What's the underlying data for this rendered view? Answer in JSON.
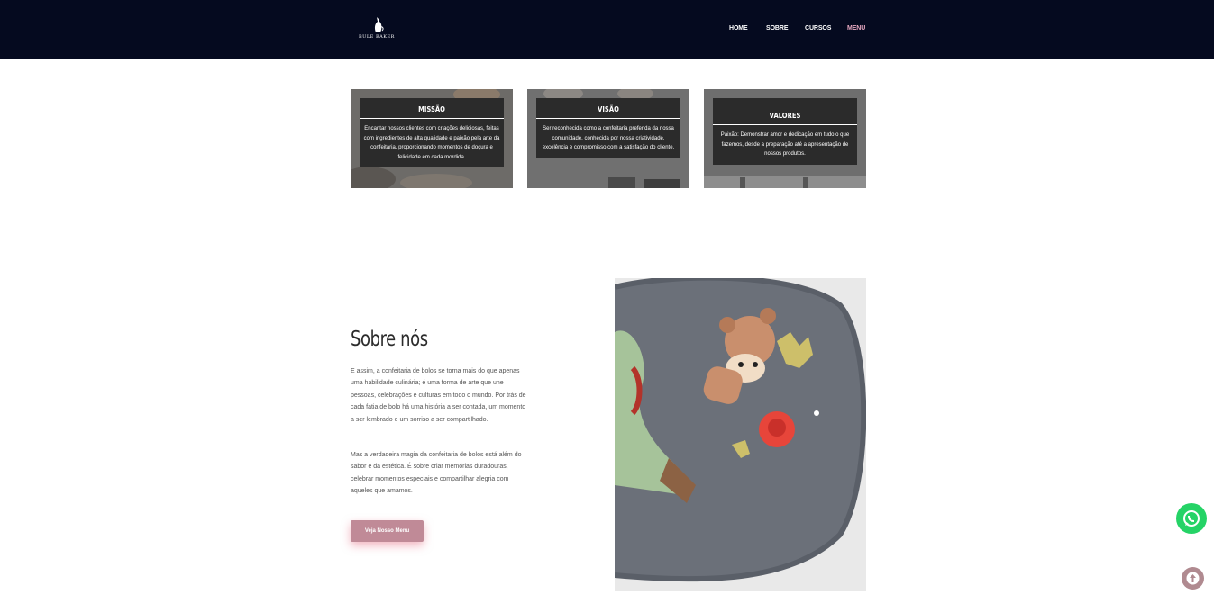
{
  "header": {
    "logo_text": "BULE BAKER",
    "nav": [
      {
        "label": "HOME"
      },
      {
        "label": "SOBRE"
      },
      {
        "label": "CURSOS"
      },
      {
        "label": "MENU"
      }
    ],
    "active_nav": "MENU"
  },
  "cards": [
    {
      "title": "MISSÃO",
      "text": "Encantar nossos clientes com criações deliciosas, feitas com ingredientes de alta qualidade e paixão pela arte da confeitaria, proporcionando momentos de doçura e felicidade em cada mordida."
    },
    {
      "title": "VISÃO",
      "text": "Ser reconhecida como a confeitaria preferida da nossa comunidade, conhecida por nossa criatividade, excelência e compromisso com a satisfação do cliente."
    },
    {
      "title": "VALORES",
      "text": "Paixão: Demonstrar amor e dedicação em tudo o que fazemos, desde a preparação até a apresentação de nossos produtos."
    }
  ],
  "about": {
    "title": "Sobre nós",
    "paragraph1": "E assim, a confeitaria de bolos se torna mais do que apenas uma habilidade culinária; é uma forma de arte que une pessoas, celebrações e culturas em todo o mundo. Por trás de cada fatia de bolo há uma história a ser contada, um momento a ser lembrado e um sorriso a ser compartilhado.",
    "paragraph2": "Mas a verdadeira magia da confeitaria de bolos está além do sabor e da estética. É sobre criar memórias duradouras, celebrar momentos especiais e compartilhar alegria com aqueles que amamos.",
    "button_label": "Veja Nosso Menu"
  },
  "colors": {
    "header_bg": "#050a1f",
    "active_nav": "#e8a9c2",
    "button": "#c08a97",
    "whatsapp": "#25d366"
  },
  "icons": [
    "logo-icon",
    "whatsapp-icon",
    "arrow-up-icon"
  ]
}
